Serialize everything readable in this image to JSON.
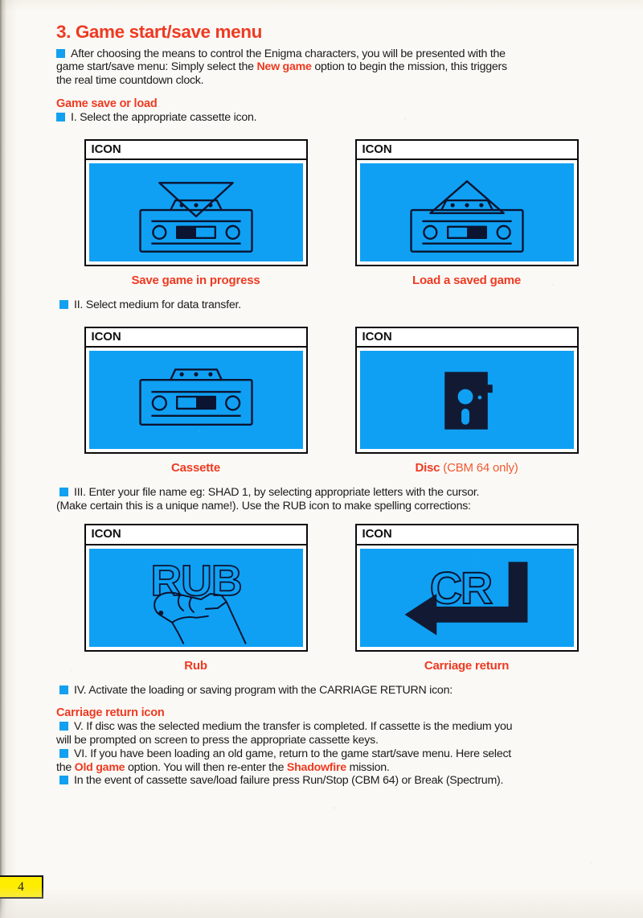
{
  "page": {
    "number": "4",
    "accent_red": "#ee3a22",
    "accent_blue": "#0fa0f4",
    "page_chip_bg": "#ffed00"
  },
  "section": {
    "title": "3. Game start/save menu",
    "intro_line1_pre": "After choosing the means to control the Enigma characters, you will be presented with the",
    "intro_line2_pre": "game start/save menu: Simply select the ",
    "intro_highlight": "New game",
    "intro_line2_post": " option to begin the mission, this triggers",
    "intro_line3": "the real time countdown clock."
  },
  "save_or_load": {
    "heading": "Game save or load",
    "step_1": "I. Select the appropriate cassette icon.",
    "step_2": "II. Select medium for data transfer.",
    "step_3_line1": "III. Enter your file name eg: SHAD 1, by selecting appropriate letters with the cursor.",
    "step_3_line2": "(Make certain this is a unique name!). Use the RUB icon to make spelling corrections:",
    "step_4": "IV. Activate the loading or saving program with the CARRIAGE RETURN icon:"
  },
  "icon_boxes": {
    "header_label": "ICON",
    "row_1": [
      {
        "icon": "save-cassette-icon",
        "caption": "Save game in progress"
      },
      {
        "icon": "load-cassette-icon",
        "caption": "Load a saved game"
      }
    ],
    "row_2": [
      {
        "icon": "cassette-icon",
        "caption": "Cassette",
        "caption_suffix": ""
      },
      {
        "icon": "floppy-disc-icon",
        "caption": "Disc",
        "caption_suffix": " (CBM 64 only)"
      }
    ],
    "row_3": [
      {
        "icon": "rub-hand-icon",
        "caption": "Rub"
      },
      {
        "icon": "carriage-return-icon",
        "caption": "Carriage return"
      }
    ]
  },
  "carriage_return_section": {
    "heading": "Carriage return icon",
    "step_5_line1": "V. If disc was the selected medium the transfer is completed. If cassette is the medium you",
    "step_5_line2": "will be prompted on screen to press the appropriate cassette keys.",
    "step_6_line1": "VI. If you have been loading an old game, return to the game start/save menu. Here select",
    "step_6_line2_pre": "the ",
    "step_6_highlight_1": "Old game",
    "step_6_line2_mid": " option. You will then re-enter the ",
    "step_6_highlight_2": "Shadowfire",
    "step_6_line2_post": " mission.",
    "step_7": "In the event of cassette save/load failure press Run/Stop (CBM 64) or Break (Spectrum)."
  }
}
